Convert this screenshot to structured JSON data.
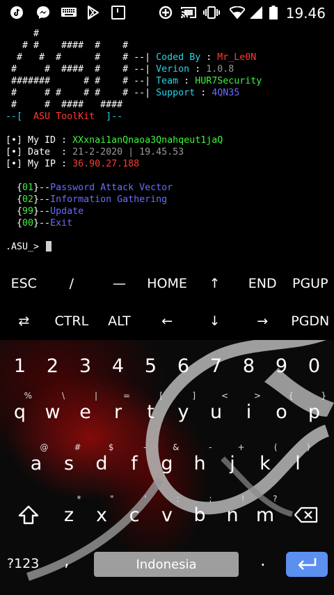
{
  "status": {
    "time": "19.46",
    "icons": [
      "tiktok-icon",
      "messenger-icon",
      "keyboard-icon",
      "play-store-icon",
      "screenshot-icon",
      "data-saver-icon",
      "cast-icon",
      "vibrate-icon",
      "wifi-icon",
      "signal-icon",
      "battery-icon"
    ]
  },
  "terminal": {
    "banner": [
      "     #",
      "   # #    ####  #    #",
      "  #   #  #      #    #",
      " #     #  ####  #    #",
      " #######      # #    #",
      " #     # #    # #    #",
      " #     #  ####   ####"
    ],
    "info": [
      {
        "label": "Coded By",
        "value": "Mr_Le0N"
      },
      {
        "label": "Verion",
        "value": "1.0.8"
      },
      {
        "label": "Team",
        "value": "HUR7Security"
      },
      {
        "label": "Support",
        "value": "4QN35"
      }
    ],
    "toolkit_prefix": "--[",
    "toolkit_name": "ASU ToolKit",
    "toolkit_suffix": "]--",
    "my_id_label": "[•] My ID :",
    "my_id_value": "XXxnai1anQnaoa3Qnahqeut1jaQ",
    "date_label": "[•] Date  :",
    "date_value": "21-2-2020 | 19.45.53",
    "ip_label": "[•] My IP :",
    "ip_value": "36.90.27.188",
    "menu": [
      {
        "num": "01",
        "label": "Password Attack Vector"
      },
      {
        "num": "02",
        "label": "Information Gathering"
      },
      {
        "num": "99",
        "label": "Update"
      },
      {
        "num": "00",
        "label": "Exit"
      }
    ],
    "prompt": ".ASU_>"
  },
  "extra_keys": {
    "row1": [
      "ESC",
      "/",
      "—",
      "HOME",
      "↑",
      "END",
      "PGUP"
    ],
    "row2": [
      "⇄",
      "CTRL",
      "ALT",
      "←",
      "↓",
      "→",
      "PGDN"
    ]
  },
  "keyboard": {
    "numbers": [
      "1",
      "2",
      "3",
      "4",
      "5",
      "6",
      "7",
      "8",
      "9",
      "0"
    ],
    "row1": [
      {
        "k": "q",
        "h": "%"
      },
      {
        "k": "w",
        "h": "\\"
      },
      {
        "k": "e",
        "h": "|"
      },
      {
        "k": "r",
        "h": "="
      },
      {
        "k": "t",
        "h": "["
      },
      {
        "k": "y",
        "h": "]"
      },
      {
        "k": "u",
        "h": "<"
      },
      {
        "k": "i",
        "h": ">"
      },
      {
        "k": "o",
        "h": "{"
      },
      {
        "k": "p",
        "h": "}"
      }
    ],
    "row2": [
      {
        "k": "a",
        "h": "@"
      },
      {
        "k": "s",
        "h": "#"
      },
      {
        "k": "d",
        "h": "$"
      },
      {
        "k": "f",
        "h": "-"
      },
      {
        "k": "g",
        "h": "&"
      },
      {
        "k": "h",
        "h": "-"
      },
      {
        "k": "j",
        "h": "+"
      },
      {
        "k": "k",
        "h": "("
      },
      {
        "k": "l",
        "h": ")"
      }
    ],
    "row3": [
      {
        "k": "z",
        "h": "*"
      },
      {
        "k": "x",
        "h": "\""
      },
      {
        "k": "c",
        "h": "'"
      },
      {
        "k": "v",
        "h": ":"
      },
      {
        "k": "b",
        "h": ";"
      },
      {
        "k": "n",
        "h": "!"
      },
      {
        "k": "m",
        "h": "?"
      }
    ],
    "sym_label": "?123",
    "comma": ",",
    "space_label": "Indonesia",
    "period": "."
  },
  "colors": {
    "cyan": "#27d5e8",
    "red": "#ff3b30",
    "green": "#3cf53c",
    "blue": "#6b6bff",
    "enter": "#5b8ff0"
  }
}
